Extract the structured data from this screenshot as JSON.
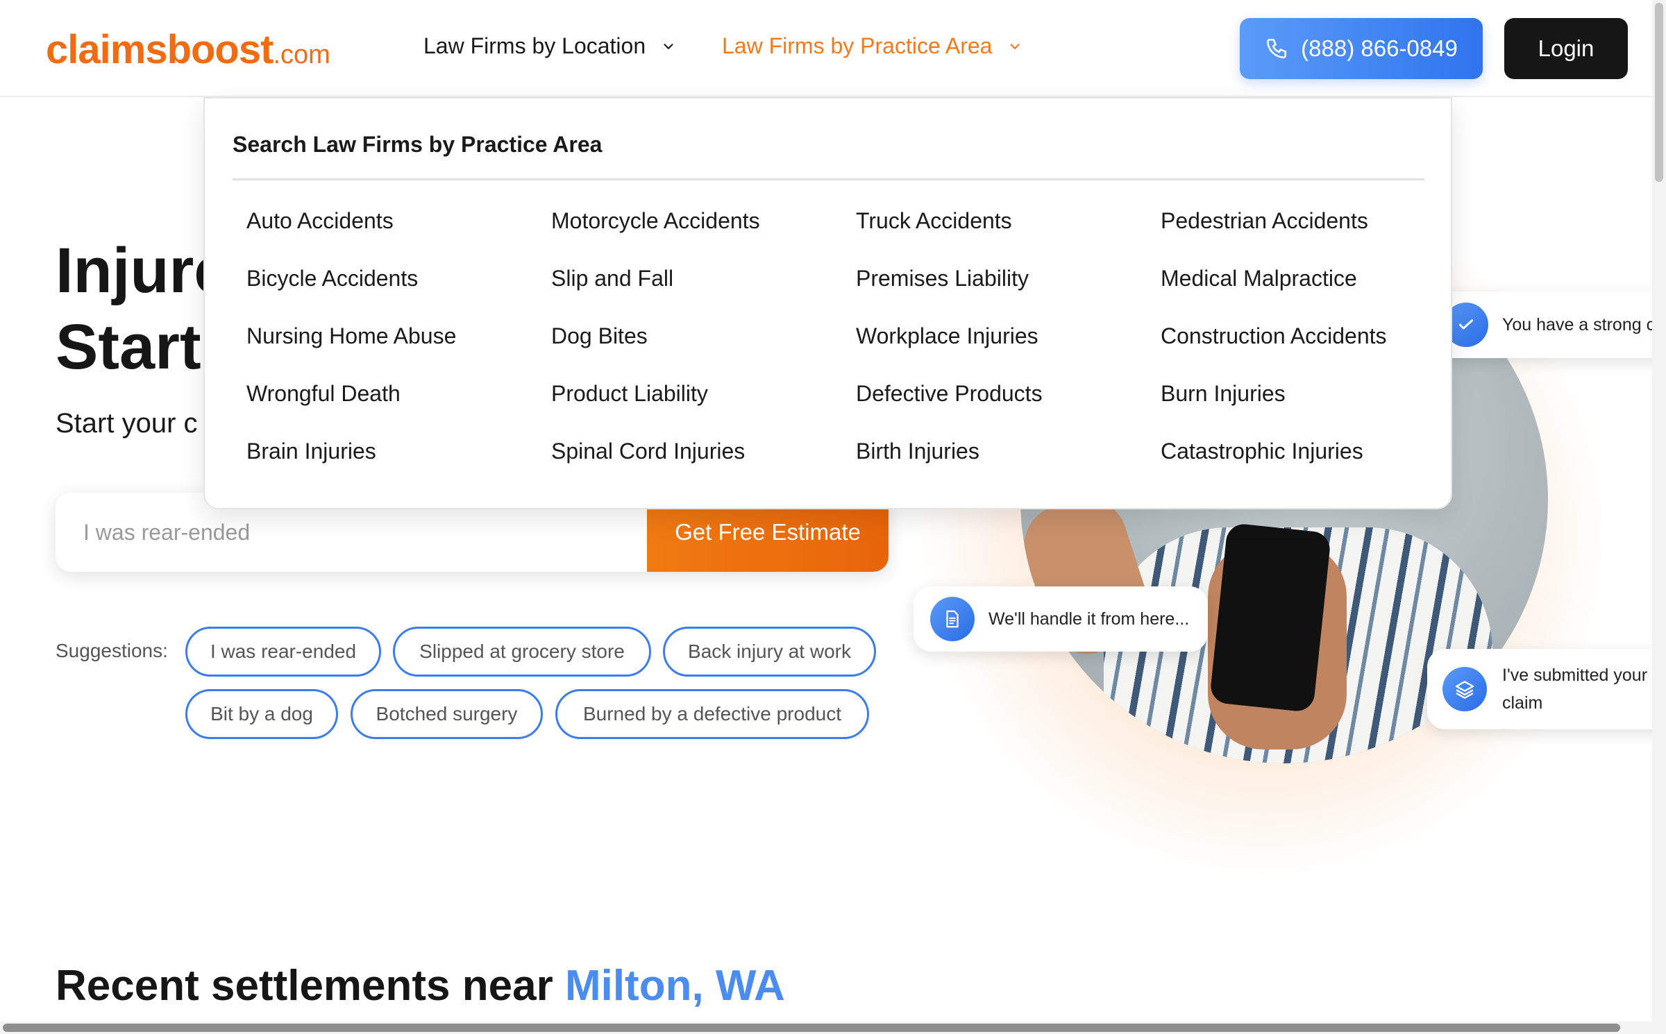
{
  "header": {
    "logo_main": "claimsboost",
    "logo_tld": ".com",
    "nav_location": "Law Firms by Location",
    "nav_practice_area": "Law Firms by Practice Area",
    "phone": "(888) 866-0849",
    "login": "Login"
  },
  "hero": {
    "title_line1": "Injure",
    "title_line2": "Start",
    "subtitle": "Start your c",
    "search_placeholder": "I was rear-ended",
    "cta": "Get Free Estimate",
    "suggestions_label": "Suggestions:",
    "suggestions": [
      "I was rear-ended",
      "Slipped at grocery store",
      "Back injury at work",
      "Bit by a dog",
      "Botched surgery",
      "Burned by a defective product"
    ]
  },
  "bubbles": {
    "strong_case": "You have a strong cas",
    "handle_it": "We'll handle it from here...",
    "submitted": "I've submitted your claim"
  },
  "settlements": {
    "prefix": "Recent settlements near ",
    "city": "Milton, WA"
  },
  "dropdown": {
    "title": "Search Law Firms by Practice Area",
    "items": [
      "Auto Accidents",
      "Motorcycle Accidents",
      "Truck Accidents",
      "Pedestrian Accidents",
      "Bicycle Accidents",
      "Slip and Fall",
      "Premises Liability",
      "Medical Malpractice",
      "Nursing Home Abuse",
      "Dog Bites",
      "Workplace Injuries",
      "Construction Accidents",
      "Wrongful Death",
      "Product Liability",
      "Defective Products",
      "Burn Injuries",
      "Brain Injuries",
      "Spinal Cord Injuries",
      "Birth Injuries",
      "Catastrophic Injuries"
    ]
  },
  "colors": {
    "brand_orange": "#f06c12",
    "accent_blue": "#3b7ded",
    "dark_button": "#161616"
  },
  "icons": [
    "chevron-down-icon",
    "phone-icon",
    "document-icon",
    "layers-icon"
  ]
}
